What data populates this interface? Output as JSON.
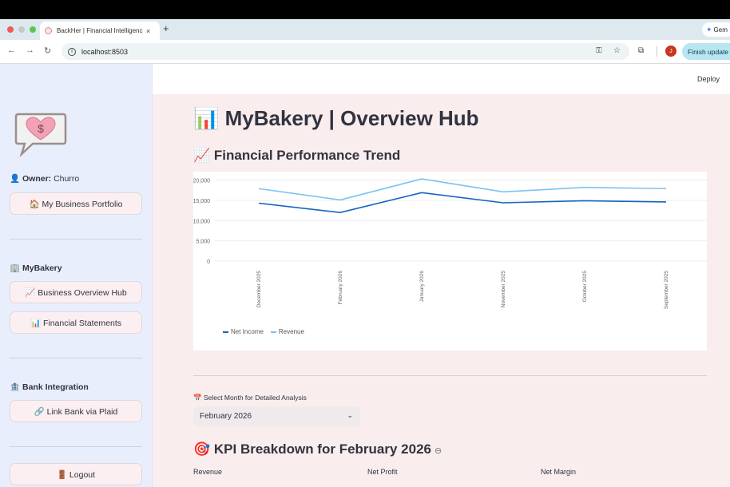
{
  "browser": {
    "tab_title": "BackHer | Financial Intelligence",
    "tab_close": "×",
    "new_tab": "+",
    "gemini_label": "Gem",
    "url": "localhost:8503",
    "finish_update": "Finish update",
    "profile_initial": "J"
  },
  "header": {
    "deploy_label": "Deploy"
  },
  "sidebar": {
    "owner_prefix": "👤 Owner:",
    "owner_name": " Churro",
    "portfolio_button": "🏠 My Business Portfolio",
    "section_business": "🏢 MyBakery",
    "overview_button": "📈 Business Overview Hub",
    "statements_button": "📊 Financial Statements",
    "section_bank": "🏦 Bank Integration",
    "plaid_button": "🔗 Link Bank via Plaid",
    "logout_button": "🚪 Logout"
  },
  "main": {
    "page_title": "📊 MyBakery | Overview Hub",
    "trend_title": "📈 Financial Performance Trend",
    "month_select_label": "📅 Select Month for Detailed Analysis",
    "month_selected": "February 2026",
    "kpi_title": "🎯 KPI Breakdown for February 2026",
    "kpi_link_icon": "⊖",
    "kpi_labels": [
      "Revenue",
      "Net Profit",
      "Net Margin"
    ]
  },
  "chart_data": {
    "type": "line",
    "categories": [
      "December 2025",
      "February 2026",
      "January 2026",
      "November 2025",
      "October 2025",
      "September 2025"
    ],
    "series": [
      {
        "name": "Net Income",
        "values": [
          14300,
          12000,
          16900,
          14400,
          14900,
          14600
        ],
        "color": "#1565c0"
      },
      {
        "name": "Revenue",
        "values": [
          17900,
          15100,
          20300,
          17100,
          18200,
          17900
        ],
        "color": "#7cc3f2"
      }
    ],
    "y_ticks": [
      "0",
      "5,000",
      "10,000",
      "15,000",
      "20,000"
    ],
    "ylim": [
      0,
      21500
    ],
    "legend_position": "bottom-left",
    "grid": true
  }
}
